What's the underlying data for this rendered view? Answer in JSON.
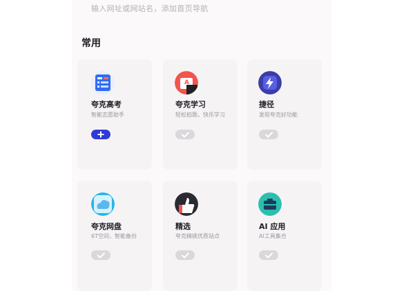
{
  "search": {
    "hint": "输入网址或网站名，添加首页导航"
  },
  "section": {
    "title": "常用"
  },
  "apps": [
    {
      "name": "夸克高考",
      "desc": "智能志愿助手",
      "state": "add",
      "icon": "gaokao-icon"
    },
    {
      "name": "夸克学习",
      "desc": "轻松拍题，快乐学习",
      "state": "added",
      "icon": "learning-icon"
    },
    {
      "name": "捷径",
      "desc": "发现夸克好功能",
      "state": "added",
      "icon": "shortcut-icon"
    },
    {
      "name": "夸克网盘",
      "desc": "6T空间，智能备份",
      "state": "added",
      "icon": "cloud-drive-icon"
    },
    {
      "name": "精选",
      "desc": "夸克精挑优质站点",
      "state": "added",
      "icon": "featured-icon"
    },
    {
      "name": "AI 应用",
      "desc": "AI工具集合",
      "state": "added",
      "icon": "ai-apps-icon"
    }
  ],
  "colors": {
    "accent": "#2e3bd6",
    "toggle_off": "#dbd8dc",
    "text_primary": "#1f1f24",
    "text_secondary": "#9a969c"
  }
}
